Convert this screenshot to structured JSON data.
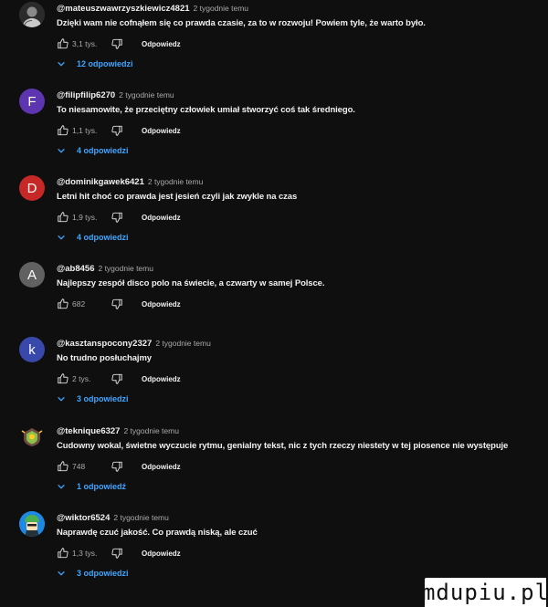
{
  "comments": [
    {
      "author": "@mateuszwawrzyszkiewicz4821",
      "time": "2 tygodnie temu",
      "text": "Dzięki wam nie cofnąłem się co prawda czasie, za to w rozwoju! Powiem tyle, że warto było.",
      "likes": "3,1 tys.",
      "reply_label": "Odpowiedz",
      "replies_label": "12 odpowiedzi",
      "avatar": {
        "type": "photo",
        "letter": "",
        "color": "#3a3a3a"
      }
    },
    {
      "author": "@filipfilip6270",
      "time": "2 tygodnie temu",
      "text": "To niesamowite, że przeciętny człowiek umiał stworzyć coś tak średniego.",
      "likes": "1,1 tys.",
      "reply_label": "Odpowiedz",
      "replies_label": "4 odpowiedzi",
      "avatar": {
        "type": "letter",
        "letter": "F",
        "color": "#5e35b1"
      }
    },
    {
      "author": "@dominikgawek6421",
      "time": "2 tygodnie temu",
      "text": "Letni hit choć co prawda jest jesień czyli jak zwykle na czas",
      "likes": "1,9 tys.",
      "reply_label": "Odpowiedz",
      "replies_label": "4 odpowiedzi",
      "avatar": {
        "type": "letter",
        "letter": "D",
        "color": "#c62828"
      }
    },
    {
      "author": "@ab8456",
      "time": "2 tygodnie temu",
      "text": "Najlepszy zespół disco polo na świecie, a czwarty w samej Polsce.",
      "likes": "682",
      "reply_label": "Odpowiedz",
      "replies_label": "",
      "avatar": {
        "type": "letter",
        "letter": "A",
        "color": "#616161"
      }
    },
    {
      "author": "@kasztanspocony2327",
      "time": "2 tygodnie temu",
      "text": "No trudno posłuchajmy",
      "likes": "2 tys.",
      "reply_label": "Odpowiedz",
      "replies_label": "3 odpowiedzi",
      "avatar": {
        "type": "letter",
        "letter": "k",
        "color": "#3949ab"
      }
    },
    {
      "author": "@teknique6327",
      "time": "2 tygodnie temu",
      "text": "Cudowny wokal, świetne wyczucie rytmu, genialny tekst, nic z tych rzeczy niestety w tej piosence nie występuje",
      "likes": "748",
      "reply_label": "Odpowiedz",
      "replies_label": "1 odpowiedź",
      "avatar": {
        "type": "emblem",
        "letter": "",
        "color": "#0f0f0f"
      }
    },
    {
      "author": "@wiktor6524",
      "time": "2 tygodnie temu",
      "text": "Naprawdę czuć jakość. Co prawdą niską, ale czuć",
      "likes": "1,3 tys.",
      "reply_label": "Odpowiedz",
      "replies_label": "3 odpowiedzi",
      "avatar": {
        "type": "character",
        "letter": "",
        "color": "#1e88e5"
      }
    }
  ],
  "watermark": "mdupiu.pl",
  "colors": {
    "background": "#0f0f0f",
    "text": "#f1f1f1",
    "secondary": "#aaaaaa",
    "link": "#3ea6ff"
  }
}
